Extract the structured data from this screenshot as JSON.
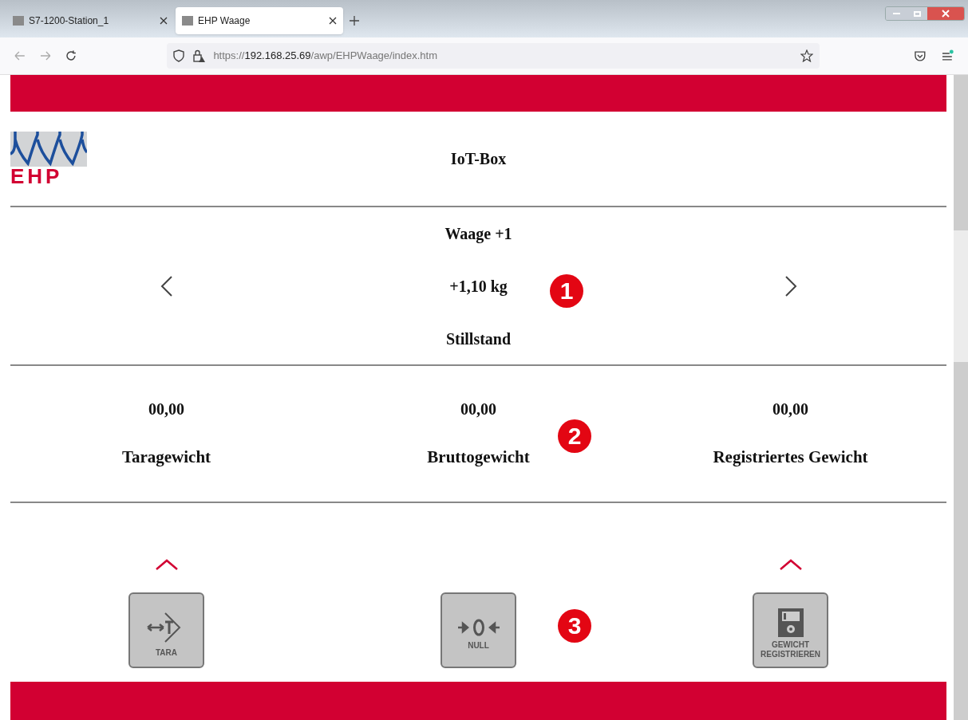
{
  "browser": {
    "tabs": [
      {
        "title": "S7-1200-Station_1",
        "selected": false
      },
      {
        "title": "EHP Waage",
        "selected": true
      }
    ],
    "url": {
      "prefix": "https://",
      "host": "192.168.25.69",
      "path": "/awp/EHPWaage/index.htm"
    }
  },
  "header": {
    "logo_text": "EHP",
    "title": "IoT-Box"
  },
  "scale": {
    "name": "Waage +1",
    "weight": "+1,10 kg",
    "status": "Stillstand",
    "badge": "1"
  },
  "weights": {
    "badge": "2",
    "items": [
      {
        "value": "00,00",
        "label": "Taragewicht"
      },
      {
        "value": "00,00",
        "label": "Bruttogewicht"
      },
      {
        "value": "00,00",
        "label": "Registriertes Gewicht"
      }
    ]
  },
  "actions": {
    "badge": "3",
    "buttons": [
      {
        "kind": "tara",
        "label": "TARA",
        "caret": true
      },
      {
        "kind": "null",
        "label": "NULL",
        "caret": false
      },
      {
        "kind": "register",
        "label": "GEWICHT REGISTRIEREN",
        "caret": true
      }
    ]
  }
}
